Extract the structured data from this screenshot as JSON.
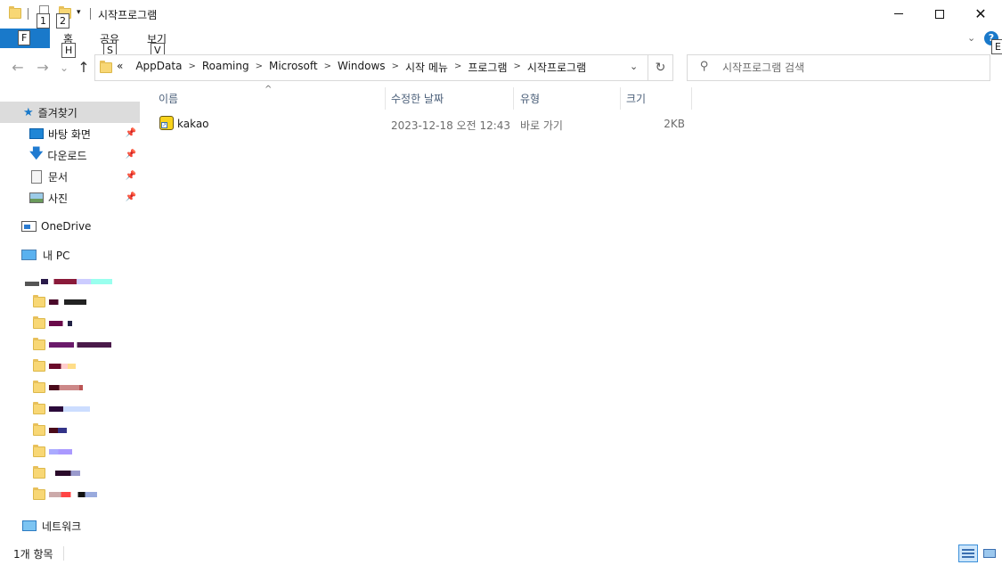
{
  "qat": {
    "key1": "1",
    "key2": "2"
  },
  "title": "시작프로그램",
  "window_controls": {
    "minimize": "—",
    "maximize": "☐",
    "close": "✕"
  },
  "ribbon": {
    "file_key": "F",
    "tabs": [
      {
        "label": "홈",
        "key": "H"
      },
      {
        "label": "공유",
        "key": "S"
      },
      {
        "label": "보기",
        "key": "V"
      }
    ],
    "help_key": "E"
  },
  "nav_buttons": {
    "back": "←",
    "forward": "→",
    "recent": "⌄",
    "up": "↑"
  },
  "address": {
    "overflow": "«",
    "crumbs": [
      "AppData",
      "Roaming",
      "Microsoft",
      "Windows",
      "시작 메뉴",
      "프로그램",
      "시작프로그램"
    ]
  },
  "search": {
    "placeholder": "시작프로그램 검색"
  },
  "nav_pane": {
    "quick_access": "즐겨찾기",
    "pinned": [
      "바탕 화면",
      "다운로드",
      "문서",
      "사진"
    ],
    "onedrive": "OneDrive",
    "this_pc": "내 PC",
    "network": "네트워크"
  },
  "columns": {
    "name": "이름",
    "modified": "수정한 날짜",
    "type": "유형",
    "size": "크기"
  },
  "files": [
    {
      "name": "kakao",
      "modified": "2023-12-18 오전 12:43",
      "type": "바로 가기",
      "size": "2KB"
    }
  ],
  "status": {
    "item_count": "1개 항목"
  },
  "colors": {
    "accent": "#1979ca",
    "folder": "#f8d775",
    "selection": "#dcdcdc"
  }
}
